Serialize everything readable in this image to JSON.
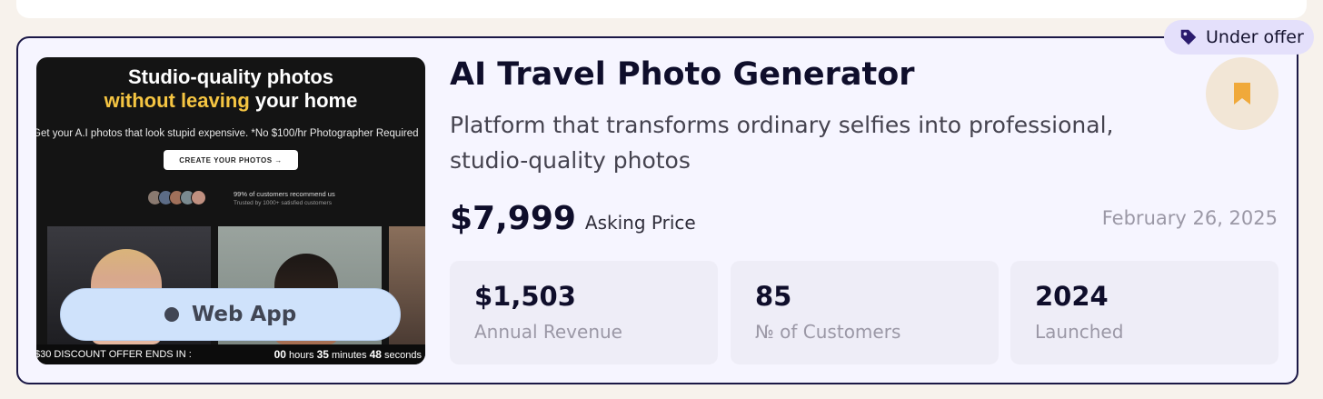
{
  "listing": {
    "status_badge": "Under offer",
    "title": "AI Travel Photo Generator",
    "description": "Platform that transforms ordinary selfies into professional, studio-quality photos",
    "category": "Web App",
    "asking_price": "$7,999",
    "asking_price_label": "Asking Price",
    "date": "February 26, 2025",
    "stats": [
      {
        "value": "$1,503",
        "label": "Annual Revenue"
      },
      {
        "value": "85",
        "label": "№ of Customers"
      },
      {
        "value": "2024",
        "label": "Launched"
      }
    ]
  },
  "thumbnail": {
    "headline_line1": "Studio-quality photos",
    "headline_highlight": "without leaving",
    "headline_rest": " your home",
    "subtext": "Get your A.I photos that look stupid expensive. *No $100/hr Photographer Required",
    "cta": "CREATE YOUR PHOTOS →",
    "recommend": "99% of customers recommend us",
    "trusted": "Trusted by 1000+ satisfied customers",
    "offer_text": "$30 DISCOUNT OFFER ENDS IN :",
    "timer_hours": "00",
    "timer_hours_label": "hours",
    "timer_minutes": "35",
    "timer_minutes_label": "minutes",
    "timer_seconds": "48",
    "timer_seconds_label": "seconds"
  },
  "icons": {
    "badge": "tag-icon",
    "bookmark": "bookmark-icon",
    "category": "dot-icon"
  },
  "colors": {
    "card_border": "#1b1846",
    "badge_bg": "#e4e0fb",
    "bookmark_icon": "#f0a93a",
    "pill_bg": "#cfe2fb"
  }
}
